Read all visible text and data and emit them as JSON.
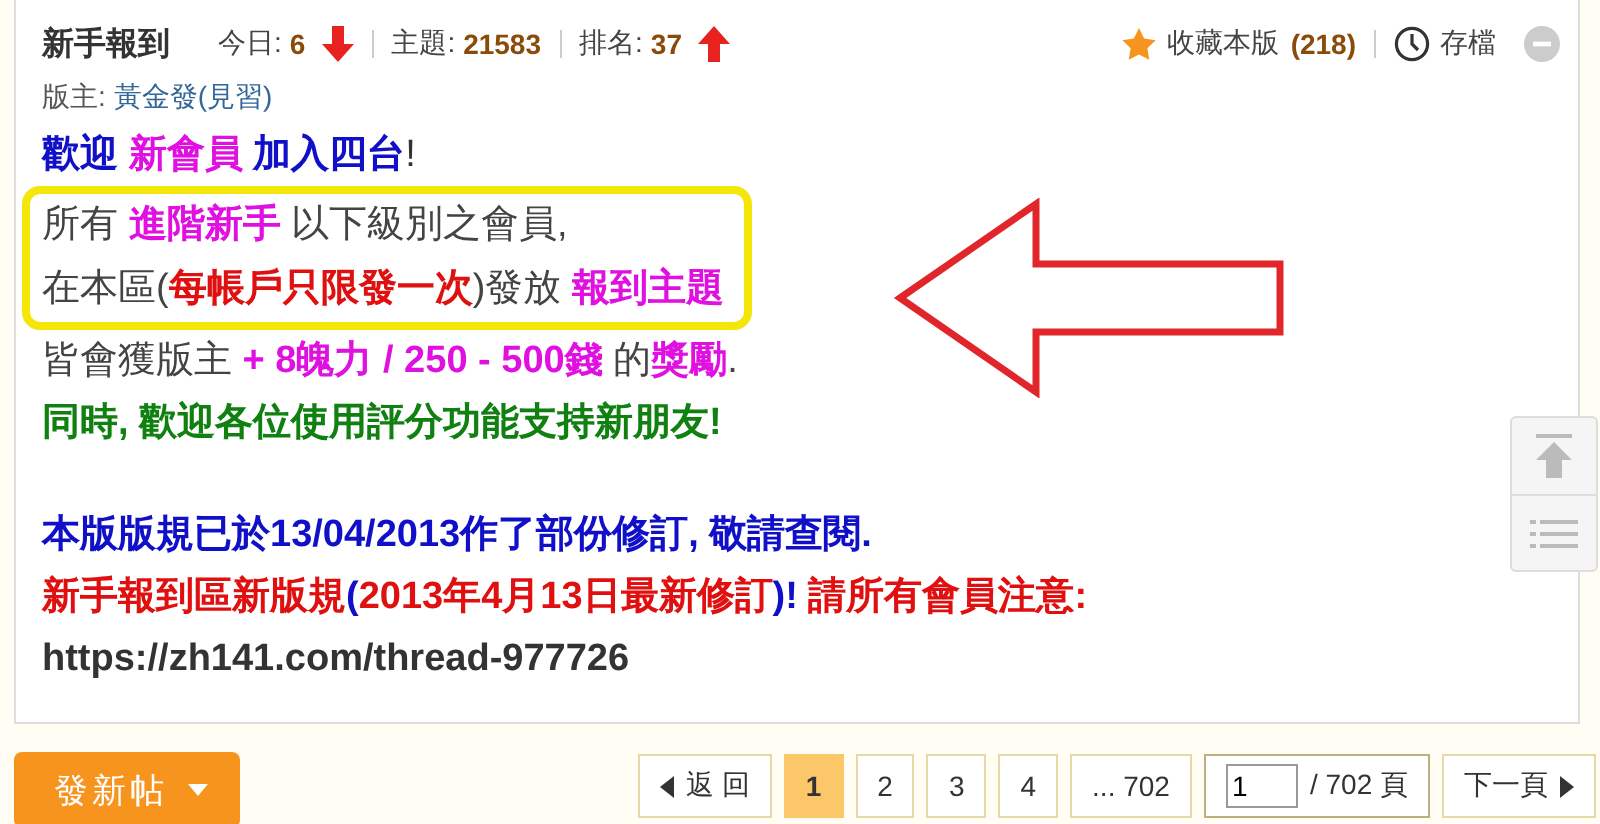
{
  "header": {
    "title": "新手報到",
    "stats": [
      {
        "label": "今日:",
        "value": "6",
        "kind": "falling"
      },
      {
        "label": "主題:",
        "value": "21583",
        "kind": "plain"
      },
      {
        "label": "排名:",
        "value": "37",
        "kind": "rising"
      }
    ],
    "favorite": {
      "label": "收藏本版",
      "count": "(218)"
    },
    "archive": {
      "label": "存檔"
    },
    "moderator": {
      "label": "版主:",
      "name": "黃金發(見習)"
    }
  },
  "notice": [
    {
      "highlighted": false,
      "gap_before": false,
      "segments": [
        {
          "text": "歡迎 ",
          "color": "#1010c8",
          "bold": true
        },
        {
          "text": "新會員",
          "color": "#e010e0",
          "bold": true
        },
        {
          "text": " 加入四台",
          "color": "#1010c8",
          "bold": true
        },
        {
          "text": "!",
          "color": "#333333",
          "bold": false
        }
      ]
    },
    {
      "highlighted": true,
      "gap_before": false,
      "segments": [
        {
          "text": "所有 ",
          "color": "#444444",
          "bold": false
        },
        {
          "text": "進階新手",
          "color": "#e010e0",
          "bold": true
        },
        {
          "text": " 以下級別之會員,",
          "color": "#444444",
          "bold": false
        }
      ]
    },
    {
      "highlighted": true,
      "gap_before": false,
      "segments": [
        {
          "text": "在本區(",
          "color": "#444444",
          "bold": false
        },
        {
          "text": "每帳戶只限發一次",
          "color": "#e01010",
          "bold": true
        },
        {
          "text": ")發放 ",
          "color": "#444444",
          "bold": false
        },
        {
          "text": "報到主題",
          "color": "#e010e0",
          "bold": true
        }
      ]
    },
    {
      "highlighted": false,
      "gap_before": false,
      "segments": [
        {
          "text": "皆會獲版主 ",
          "color": "#444444",
          "bold": false
        },
        {
          "text": "+ 8魄力 / 250 - 500錢",
          "color": "#e010e0",
          "bold": true
        },
        {
          "text": " 的",
          "color": "#444444",
          "bold": false
        },
        {
          "text": "獎勵",
          "color": "#e010e0",
          "bold": true
        },
        {
          "text": ".",
          "color": "#444444",
          "bold": false
        }
      ]
    },
    {
      "highlighted": false,
      "gap_before": false,
      "segments": [
        {
          "text": "同時, 歡迎各位使用評分功能支持新朋友!",
          "color": "#108010",
          "bold": true
        }
      ]
    },
    {
      "highlighted": false,
      "gap_before": true,
      "segments": [
        {
          "text": "本版版規已於13/04/2013作了部份修訂, 敬請查閱.",
          "color": "#1010c8",
          "bold": true
        }
      ]
    },
    {
      "highlighted": false,
      "gap_before": false,
      "segments": [
        {
          "text": "新手報到區新版規",
          "color": "#e01010",
          "bold": true
        },
        {
          "text": "(",
          "color": "#1010c8",
          "bold": true
        },
        {
          "text": "2013年4月13日最新修訂",
          "color": "#e01010",
          "bold": true
        },
        {
          "text": ")!",
          "color": "#1010c8",
          "bold": true
        },
        {
          "text": " 請所有會員注意:",
          "color": "#e01010",
          "bold": true
        }
      ]
    },
    {
      "highlighted": false,
      "gap_before": false,
      "segments": [
        {
          "text": "https://zh141.com/thread-977726",
          "color": "#333333",
          "bold": true
        }
      ]
    }
  ],
  "new_post_button": {
    "label": "發新帖"
  },
  "pagination": {
    "back": "返 回",
    "pages": [
      {
        "label": "1",
        "selected": true
      },
      {
        "label": "2",
        "selected": false
      },
      {
        "label": "3",
        "selected": false
      },
      {
        "label": "4",
        "selected": false
      },
      {
        "label": "... 702",
        "selected": false
      }
    ],
    "jump": {
      "value": "1",
      "total": "/ 702 頁"
    },
    "next": "下一頁"
  }
}
